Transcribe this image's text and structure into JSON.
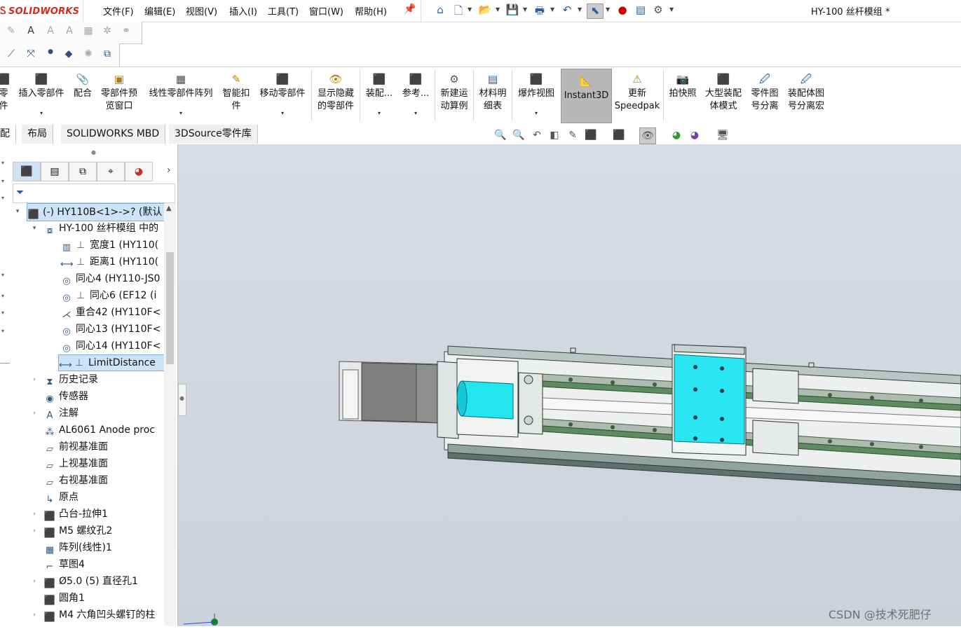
{
  "app": {
    "name": "SOLIDWORKS",
    "doc_title": "HY-100 丝杆模组 *"
  },
  "menu": [
    "文件(F)",
    "编辑(E)",
    "视图(V)",
    "插入(I)",
    "工具(T)",
    "窗口(W)",
    "帮助(H)"
  ],
  "quick_access_icons": [
    "home-icon",
    "new-icon",
    "open-icon",
    "save-icon",
    "print-icon",
    "undo-icon",
    "select-icon",
    "rebuild-icon",
    "file-properties-icon",
    "options-icon"
  ],
  "command_manager": {
    "items": [
      {
        "label1": "零",
        "label2": "件"
      },
      {
        "label1": "插入零部件",
        "label2": ""
      },
      {
        "label1": "配合",
        "label2": ""
      },
      {
        "label1": "零部件预",
        "label2": "览窗口"
      },
      {
        "label1": "线性零部件阵列",
        "label2": ""
      },
      {
        "label1": "智能扣",
        "label2": "件"
      },
      {
        "label1": "移动零部件",
        "label2": ""
      },
      {
        "label1": "显示隐藏",
        "label2": "的零部件"
      },
      {
        "label1": "装配...",
        "label2": ""
      },
      {
        "label1": "参考...",
        "label2": ""
      },
      {
        "label1": "新建运",
        "label2": "动算例"
      },
      {
        "label1": "材料明",
        "label2": "细表"
      },
      {
        "label1": "爆炸视图",
        "label2": ""
      },
      {
        "label1": "Instant3D",
        "label2": ""
      },
      {
        "label1": "更新",
        "label2": "Speedpak"
      },
      {
        "label1": "拍快照",
        "label2": ""
      },
      {
        "label1": "大型装配",
        "label2": "体模式"
      },
      {
        "label1": "零件图",
        "label2": "号分离"
      },
      {
        "label1": "装配体图",
        "label2": "号分离宏"
      }
    ]
  },
  "tabs": [
    "配体",
    "布局",
    "SOLIDWORKS MBD",
    "3DSource零件库"
  ],
  "tree": {
    "root": "(-) HY110B<1>->? (默认",
    "group": "HY-100 丝杆模组 中的",
    "mates": [
      {
        "label": "宽度1 (HY110(",
        "icon": "width-mate-icon"
      },
      {
        "label": "距离1 (HY110(",
        "icon": "distance-mate-icon"
      },
      {
        "label": "同心4 (HY110-JS0",
        "icon": "concentric-mate-icon"
      },
      {
        "label": "同心6 (EF12  (i",
        "icon": "concentric-mate-icon"
      },
      {
        "label": "重合42 (HY110F<",
        "icon": "coincident-mate-icon"
      },
      {
        "label": "同心13 (HY110F<",
        "icon": "concentric-mate-icon"
      },
      {
        "label": "同心14 (HY110F<",
        "icon": "concentric-mate-icon"
      },
      {
        "label": "LimitDistance",
        "icon": "limit-distance-mate-icon"
      }
    ],
    "items": [
      {
        "label": "历史记录",
        "expand": true,
        "icon": "history-icon"
      },
      {
        "label": "传感器",
        "expand": false,
        "icon": "sensor-icon"
      },
      {
        "label": "注解",
        "expand": true,
        "icon": "annotation-icon"
      },
      {
        "label": "AL6061 Anode proc",
        "expand": false,
        "icon": "material-icon"
      },
      {
        "label": "前视基准面",
        "expand": false,
        "icon": "plane-icon"
      },
      {
        "label": "上视基准面",
        "expand": false,
        "icon": "plane-icon"
      },
      {
        "label": "右视基准面",
        "expand": false,
        "icon": "plane-icon"
      },
      {
        "label": "原点",
        "expand": false,
        "icon": "origin-icon"
      },
      {
        "label": "凸台-拉伸1",
        "expand": true,
        "icon": "extrude-icon"
      },
      {
        "label": "M5 螺纹孔2",
        "expand": true,
        "icon": "hole-icon"
      },
      {
        "label": "阵列(线性)1",
        "expand": false,
        "icon": "linear-pattern-icon"
      },
      {
        "label": "草图4",
        "expand": false,
        "icon": "sketch-icon"
      },
      {
        "label": "Ø5.0 (5) 直径孔1",
        "expand": true,
        "icon": "hole-icon"
      },
      {
        "label": "圆角1",
        "expand": false,
        "icon": "fillet-icon"
      },
      {
        "label": "M4 六角凹头螺钉的柱",
        "expand": true,
        "icon": "hole-icon"
      }
    ]
  },
  "watermark": "CSDN @技术死肥仔",
  "colors": {
    "accent_cyan": "#22e5f0",
    "rail": "#9fb3ae",
    "brand_red": "#d52b1e",
    "viewport_bg": "#d0d5de"
  }
}
